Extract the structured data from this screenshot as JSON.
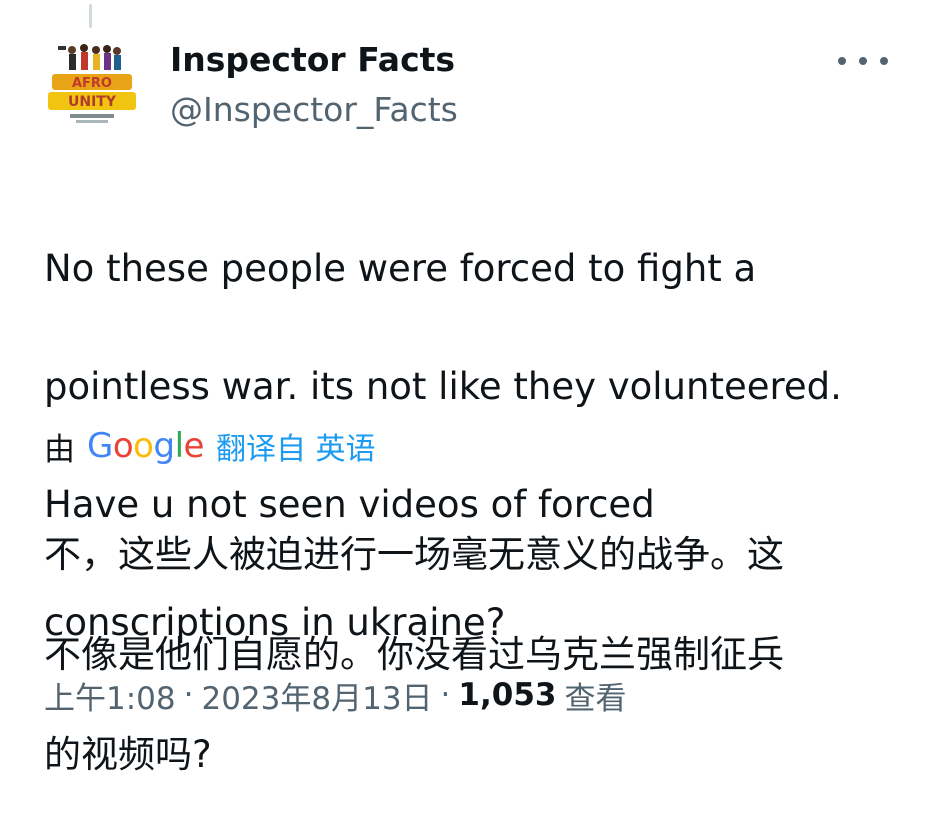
{
  "tweet": {
    "author_name": "Inspector Facts",
    "author_handle": "@Inspector_Facts",
    "avatar_text": "AFRO UNITY",
    "body_lines": [
      "No these people were forced to fight a",
      "pointless war.  its not like they volunteered.",
      "Have u not seen videos of forced",
      "conscriptions in ukraine?"
    ],
    "translation": {
      "prefix": "由",
      "provider_letters": [
        "G",
        "o",
        "o",
        "g",
        "l",
        "e"
      ],
      "provider_colors": [
        "#4285f4",
        "#ea4335",
        "#fbbc05",
        "#4285f4",
        "#34a853",
        "#ea4335"
      ],
      "link_text": "翻译自 英语",
      "translated_lines": [
        "不，这些人被迫进行一场毫无意义的战争。这",
        "不像是他们自愿的。你没看过乌克兰强制征兵",
        "的视频吗?"
      ]
    },
    "meta": {
      "time": "上午1:08",
      "separator": "·",
      "date": "2023年8月13日",
      "views_count": "1,053",
      "views_label": "查看"
    },
    "colors": {
      "text_primary": "#0f1419",
      "text_secondary": "#536471",
      "link": "#1d9bf0"
    },
    "icons": {
      "more": "more-dots-icon"
    }
  }
}
